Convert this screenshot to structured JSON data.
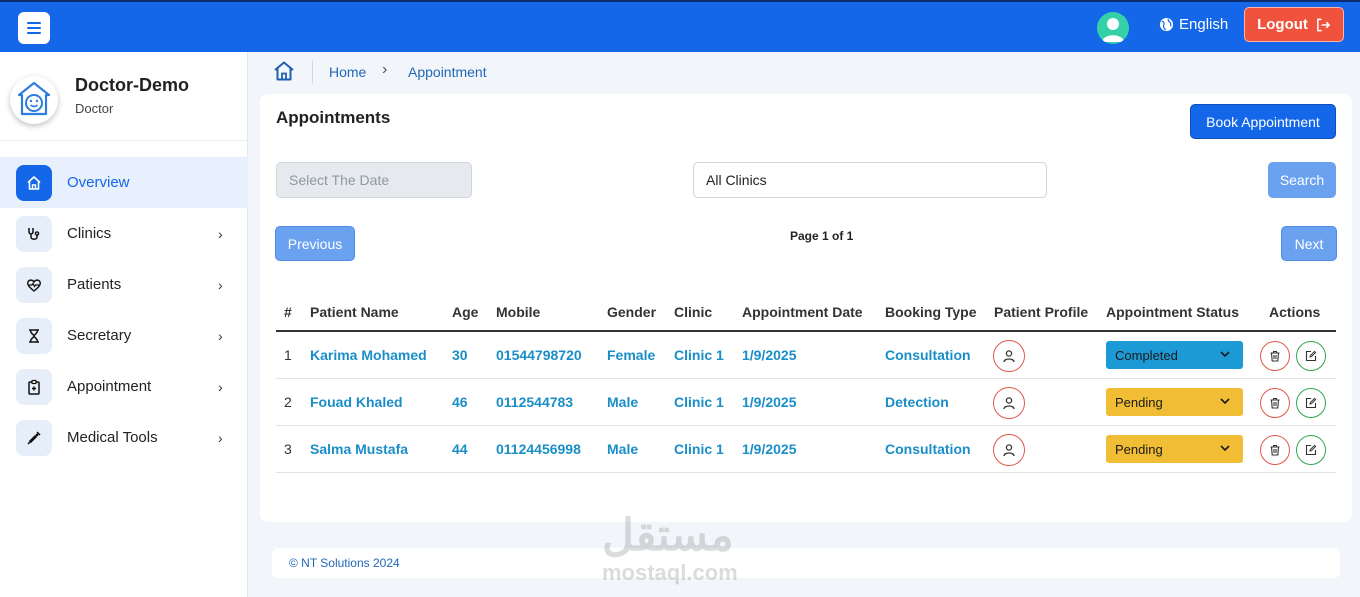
{
  "topbar": {
    "language": "English",
    "logout_label": "Logout",
    "accent": "#1467e8"
  },
  "sidebar": {
    "name": "Doctor-Demo",
    "role": "Doctor",
    "items": [
      {
        "label": "Overview",
        "icon": "home-icon",
        "active": true
      },
      {
        "label": "Clinics",
        "icon": "stethoscope-icon"
      },
      {
        "label": "Patients",
        "icon": "heart-pulse-icon"
      },
      {
        "label": "Secretary",
        "icon": "hourglass-icon"
      },
      {
        "label": "Appointment",
        "icon": "clipboard-icon"
      },
      {
        "label": "Medical Tools",
        "icon": "syringe-icon"
      }
    ]
  },
  "breadcrumb": {
    "home": "Home",
    "current": "Appointment"
  },
  "main": {
    "title": "Appointments",
    "book_button": "Book Appointment",
    "date_placeholder": "Select The Date",
    "clinic_value": "All Clinics",
    "search_button": "Search",
    "prev_button": "Previous",
    "next_button": "Next",
    "page_info": "Page 1 of 1"
  },
  "table": {
    "headers": [
      "#",
      "Patient Name",
      "Age",
      "Mobile",
      "Gender",
      "Clinic",
      "Appointment Date",
      "Booking Type",
      "Patient Profile",
      "Appointment Status",
      "Actions"
    ],
    "rows": [
      {
        "num": "1",
        "name": "Karima Mohamed",
        "age": "30",
        "mobile": "01544798720",
        "gender": "Female",
        "clinic": "Clinic 1",
        "date": "1/9/2025",
        "type": "Consultation",
        "status": "Completed",
        "status_color": "#1c9ad6"
      },
      {
        "num": "2",
        "name": "Fouad Khaled",
        "age": "46",
        "mobile": "0112544783",
        "gender": "Male",
        "clinic": "Clinic 1",
        "date": "1/9/2025",
        "type": "Detection",
        "status": "Pending",
        "status_color": "#f0bd35"
      },
      {
        "num": "3",
        "name": "Salma Mustafa",
        "age": "44",
        "mobile": "01124456998",
        "gender": "Male",
        "clinic": "Clinic 1",
        "date": "1/9/2025",
        "type": "Consultation",
        "status": "Pending",
        "status_color": "#f0bd35"
      }
    ]
  },
  "footer": {
    "text": "© NT Solutions 2024"
  },
  "watermark": {
    "arabic": "مستقل",
    "latin": "mostaql.com"
  }
}
